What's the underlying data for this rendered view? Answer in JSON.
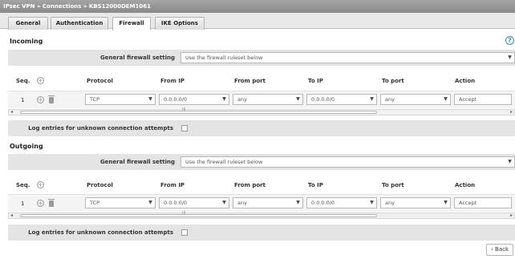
{
  "titlebar": {
    "text": "IPsec VPN » Connections » KBS12000DEM1061"
  },
  "tabs": [
    {
      "label": "General"
    },
    {
      "label": "Authentication"
    },
    {
      "label": "Firewall"
    },
    {
      "label": "IKE Options"
    }
  ],
  "incoming": {
    "title": "Incoming",
    "general_setting_label": "General firewall setting",
    "general_setting_value": "Use the firewall ruleset below",
    "columns": {
      "seq": "Seq.",
      "protocol": "Protocol",
      "from_ip": "From IP",
      "from_port": "From port",
      "to_ip": "To IP",
      "to_port": "To port",
      "action": "Action"
    },
    "rule": {
      "seq": "1",
      "protocol": "TCP",
      "from_ip": "0.0.0.0/0",
      "from_port": "any",
      "to_ip": "0.0.0.0/0",
      "to_port": "any",
      "action": "Accept"
    },
    "log_label": "Log entries for unknown connection attempts"
  },
  "outgoing": {
    "title": "Outgoing",
    "general_setting_label": "General firewall setting",
    "general_setting_value": "Use the firewall ruleset below",
    "columns": {
      "seq": "Seq.",
      "protocol": "Protocol",
      "from_ip": "From IP",
      "from_port": "From port",
      "to_ip": "To IP",
      "to_port": "To port",
      "action": "Action"
    },
    "rule": {
      "seq": "1",
      "protocol": "TCP",
      "from_ip": "0.0.0.0/0",
      "from_port": "any",
      "to_ip": "0.0.0.0/0",
      "to_port": "any",
      "action": "Accept"
    },
    "log_label": "Log entries for unknown connection attempts"
  },
  "icons": {
    "help": "?",
    "add": "+",
    "dropdown": "▼",
    "scroll_left": "◂",
    "scroll_right": "▸",
    "grip": "III",
    "back": "‹"
  },
  "back_button": {
    "label": "Back"
  }
}
